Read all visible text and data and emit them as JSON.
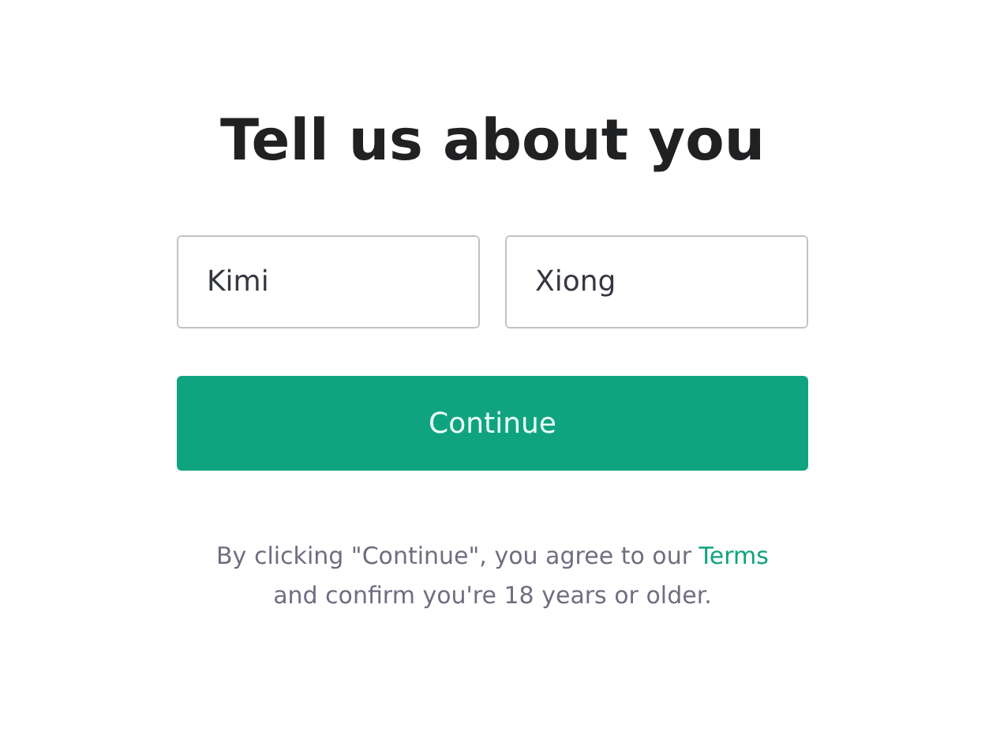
{
  "title": "Tell us about you",
  "fields": [
    {
      "value": "Kimi"
    },
    {
      "value": "Xiong"
    }
  ],
  "button": {
    "label": "Continue"
  },
  "notice": {
    "text": "By clicking \"Continue\", you agree to our",
    "link": "Terms",
    "after": "and confirm you're 18 years or older."
  }
}
